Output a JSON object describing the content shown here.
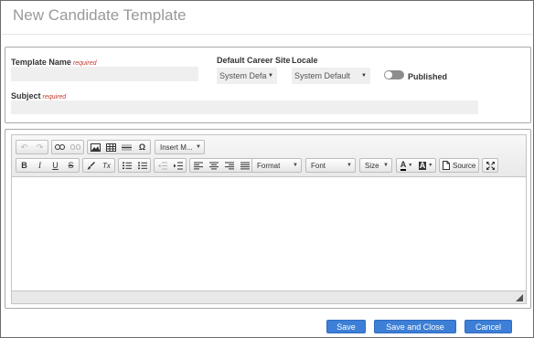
{
  "page": {
    "title": "New Candidate Template"
  },
  "form": {
    "template_name": {
      "label": "Template Name",
      "required": "required",
      "value": ""
    },
    "career_site": {
      "label": "Default Career Site",
      "value": "System Defa"
    },
    "locale": {
      "label": "Locale",
      "value": "System Default"
    },
    "published": {
      "label": "Published",
      "on": false
    },
    "subject": {
      "label": "Subject",
      "required": "required",
      "value": ""
    }
  },
  "toolbar": {
    "row1": {
      "undo": "undo-icon",
      "redo": "redo-icon",
      "link": "link-icon",
      "unlink": "unlink-icon",
      "image": "image-icon",
      "table": "table-icon",
      "hr": "horizontal-rule-icon",
      "special_char": "Ω",
      "insert_merge": "Insert M..."
    },
    "row2": {
      "bold": "B",
      "italic": "I",
      "underline": "U",
      "strike": "S",
      "format_painter": "brush-icon",
      "remove_format": "Tx",
      "format": "Format",
      "font": "Font",
      "size": "Size",
      "text_color": "A",
      "bg_color": "A",
      "source": "Source"
    }
  },
  "buttons": {
    "save": "Save",
    "save_close": "Save and Close",
    "cancel": "Cancel"
  },
  "colors": {
    "primary": "#3d7fd6",
    "required": "#c0392b"
  }
}
